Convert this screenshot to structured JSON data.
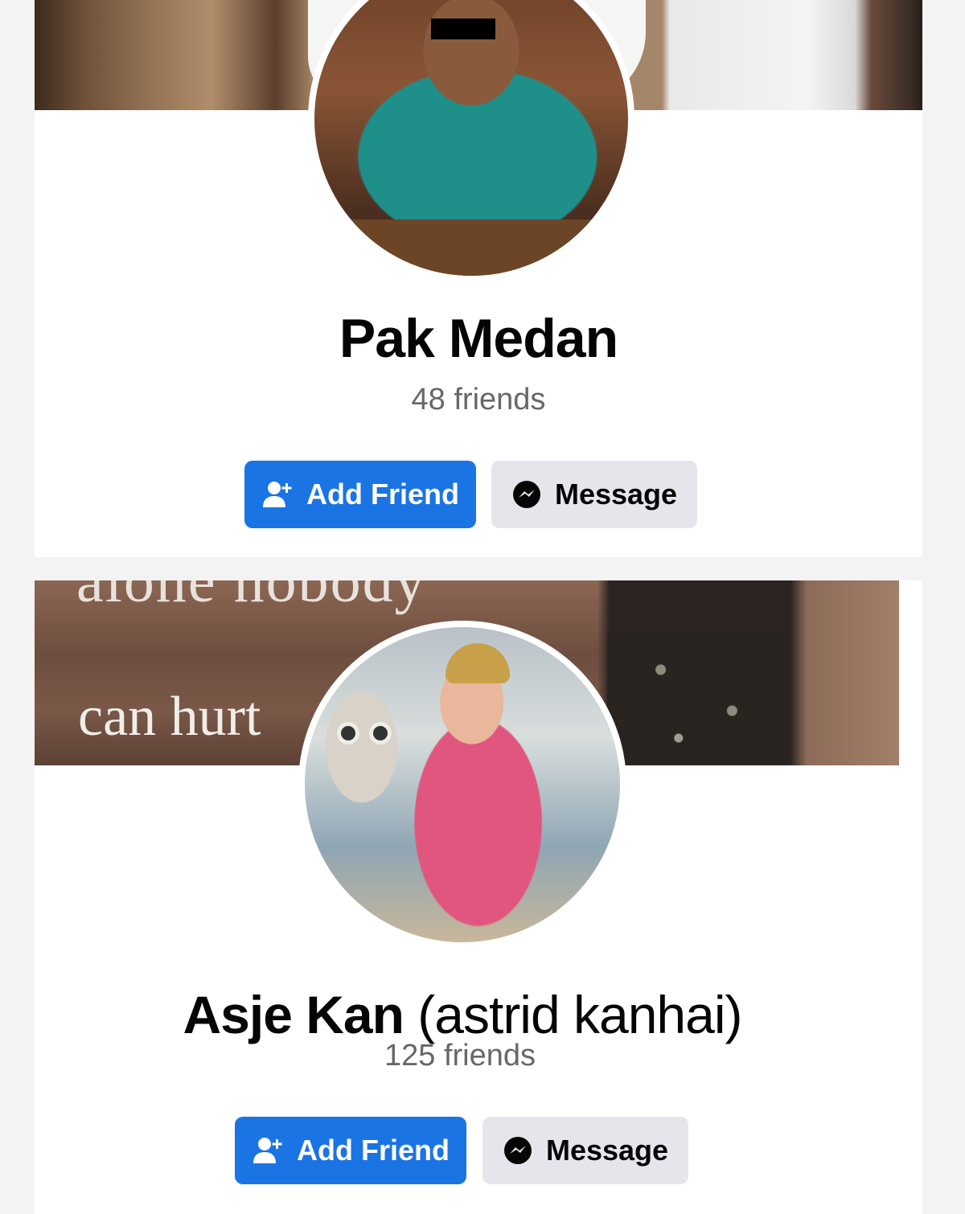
{
  "profiles": [
    {
      "name": "Pak Medan",
      "alt_name": "",
      "friends": "48 friends",
      "add_friend_label": "Add Friend",
      "message_label": "Message"
    },
    {
      "name": "Asje Kan",
      "alt_name": "(astrid kanhai)",
      "friends": "125 friends",
      "add_friend_label": "Add Friend",
      "message_label": "Message",
      "cover_text_top": "alone nobody",
      "cover_text_bottom": "can hurt"
    }
  ],
  "icons": {
    "add_friend": "add-person-icon",
    "message": "messenger-icon"
  },
  "colors": {
    "primary_button": "#1b74e4",
    "secondary_button": "#e4e6eb",
    "friends_text": "#65676b"
  }
}
